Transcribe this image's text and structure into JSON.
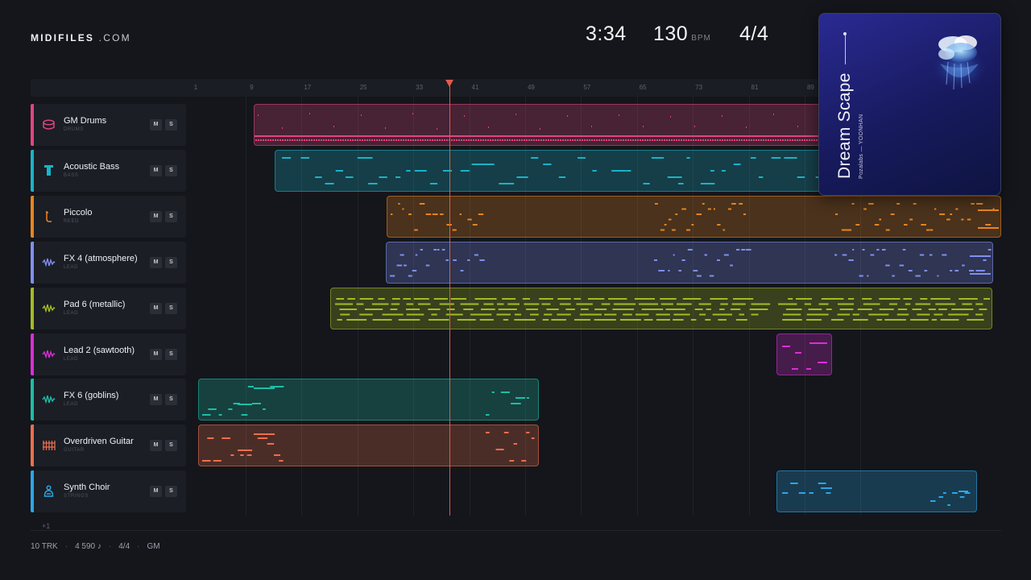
{
  "header": {
    "brand_bold": "MIDIFILES",
    "brand_rest": " .COM",
    "duration": "3:34",
    "tempo": "130",
    "tempo_unit": "BPM",
    "time_signature": "4/4"
  },
  "ruler": {
    "ticks": [
      "1",
      "9",
      "17",
      "25",
      "33",
      "41",
      "49",
      "57",
      "65",
      "73",
      "81",
      "89"
    ]
  },
  "tracks": [
    {
      "name": "GM Drums",
      "category": "DRUMS",
      "color": "#e0457f",
      "icon": "drum-icon",
      "mute": "M",
      "solo": "S"
    },
    {
      "name": "Acoustic Bass",
      "category": "BASS",
      "color": "#1ab3c7",
      "icon": "bass-icon",
      "mute": "M",
      "solo": "S"
    },
    {
      "name": "Piccolo",
      "category": "REED",
      "color": "#e78420",
      "icon": "reed-icon",
      "mute": "M",
      "solo": "S"
    },
    {
      "name": "FX 4 (atmosphere)",
      "category": "LEAD",
      "color": "#7f8ff0",
      "icon": "waveform-icon",
      "mute": "M",
      "solo": "S"
    },
    {
      "name": "Pad 6 (metallic)",
      "category": "LEAD",
      "color": "#a4bb24",
      "icon": "waveform-icon",
      "mute": "M",
      "solo": "S"
    },
    {
      "name": "Lead 2 (sawtooth)",
      "category": "LEAD",
      "color": "#d92ed6",
      "icon": "waveform-icon",
      "mute": "M",
      "solo": "S"
    },
    {
      "name": "FX 6 (goblins)",
      "category": "LEAD",
      "color": "#20bca6",
      "icon": "waveform-icon",
      "mute": "M",
      "solo": "S"
    },
    {
      "name": "Overdriven Guitar",
      "category": "GUITAR",
      "color": "#ec6f4e",
      "icon": "guitar-icon",
      "mute": "M",
      "solo": "S"
    },
    {
      "name": "Synth Choir",
      "category": "STRINGS",
      "color": "#2ba6e6",
      "icon": "choir-icon",
      "mute": "M",
      "solo": "S"
    }
  ],
  "more_tracks": "+1",
  "footer": {
    "tracks": "10 TRK",
    "notes": "4 590 ♪",
    "meter": "4/4",
    "standard": "GM"
  },
  "album": {
    "title": "Dream Scape",
    "artist": "Pozalabs — YOONHAN"
  }
}
